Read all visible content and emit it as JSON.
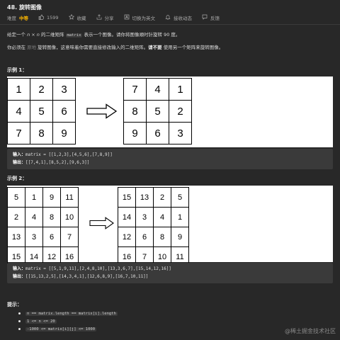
{
  "title": "48. 旋转图像",
  "meta": {
    "difficulty_label": "难度",
    "difficulty": "中等",
    "likes": "1599",
    "favorite": "收藏",
    "share": "分享",
    "switch_lang": "切换为英文",
    "notify": "接收动态",
    "feedback": "反馈"
  },
  "desc": {
    "p1_a": "给定一个 ",
    "p1_n": "n × n",
    "p1_b": " 的二维矩阵 ",
    "p1_code": "matrix",
    "p1_c": " 表示一个图像。请你将图像顺时针旋转 90 度。",
    "p2_a": "你必须在 ",
    "p2_faint": "原地",
    "p2_b": " 旋转图像，这意味着你需要直接修改输入的二维矩阵。",
    "p2_strong": "请不要",
    "p2_c": " 使用另一个矩阵来旋转图像。"
  },
  "example1": {
    "heading": "示例 1：",
    "left": [
      [
        "1",
        "2",
        "3"
      ],
      [
        "4",
        "5",
        "6"
      ],
      [
        "7",
        "8",
        "9"
      ]
    ],
    "right": [
      [
        "7",
        "4",
        "1"
      ],
      [
        "8",
        "5",
        "2"
      ],
      [
        "9",
        "6",
        "3"
      ]
    ],
    "input_label": "输入：",
    "input": "matrix = [[1,2,3],[4,5,6],[7,8,9]]",
    "output_label": "输出：",
    "output": "[[7,4,1],[8,5,2],[9,6,3]]"
  },
  "example2": {
    "heading": "示例 2：",
    "left": [
      [
        "5",
        "1",
        "9",
        "11"
      ],
      [
        "2",
        "4",
        "8",
        "10"
      ],
      [
        "13",
        "3",
        "6",
        "7"
      ],
      [
        "15",
        "14",
        "12",
        "16"
      ]
    ],
    "right": [
      [
        "15",
        "13",
        "2",
        "5"
      ],
      [
        "14",
        "3",
        "4",
        "1"
      ],
      [
        "12",
        "6",
        "8",
        "9"
      ],
      [
        "16",
        "7",
        "10",
        "11"
      ]
    ],
    "input_label": "输入：",
    "input": "matrix = [[5,1,9,11],[2,4,8,10],[13,3,6,7],[15,14,12,16]]",
    "output_label": "输出：",
    "output": "[[15,13,2,5],[14,3,4,1],[12,6,8,9],[16,7,10,11]]"
  },
  "tips": {
    "heading": "提示：",
    "items": [
      "n == matrix.length == matrix[i].length",
      "1 <= n <= 20",
      "-1000 <= matrix[i][j] <= 1000"
    ]
  },
  "watermark": "@稀土掘金技术社区",
  "colors": {
    "background": "#282828",
    "difficulty": "#ffb800",
    "code_bg": "#3a3a3a"
  }
}
